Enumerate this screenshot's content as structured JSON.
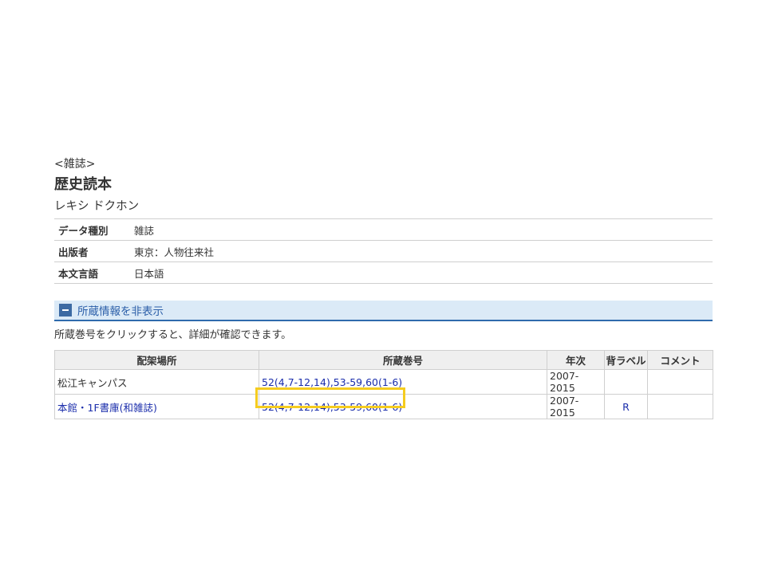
{
  "record": {
    "genre": "<雑誌>",
    "title": "歴史読本",
    "reading": "レキシ ドクホン"
  },
  "meta": [
    {
      "key": "データ種別",
      "value": "雑誌"
    },
    {
      "key": "出版者",
      "value": "東京：人物往来社"
    },
    {
      "key": "本文言語",
      "value": "日本語"
    }
  ],
  "holdings_section": {
    "toggle_label": "所蔵情報を非表示",
    "instruction": "所蔵巻号をクリックすると、詳細が確認できます。"
  },
  "holdings_table": {
    "headers": [
      "配架場所",
      "所蔵巻号",
      "年次",
      "背ラベル",
      "コメント"
    ],
    "rows": [
      {
        "location": "松江キャンパス",
        "volumes": "52(4,7-12,14),53-59,60(1-6)",
        "years": "2007-2015",
        "label": "",
        "comment": ""
      },
      {
        "location": "本館・1F書庫(和雑誌)",
        "volumes": "52(4,7-12,14),53-59,60(1-6)",
        "years": "2007-2015",
        "label": "R",
        "comment": ""
      }
    ]
  },
  "colors": {
    "link": "#1a2dab",
    "section_bg": "#dbeaf7",
    "section_border": "#2f6bad",
    "highlight": "#f5cc1f"
  }
}
